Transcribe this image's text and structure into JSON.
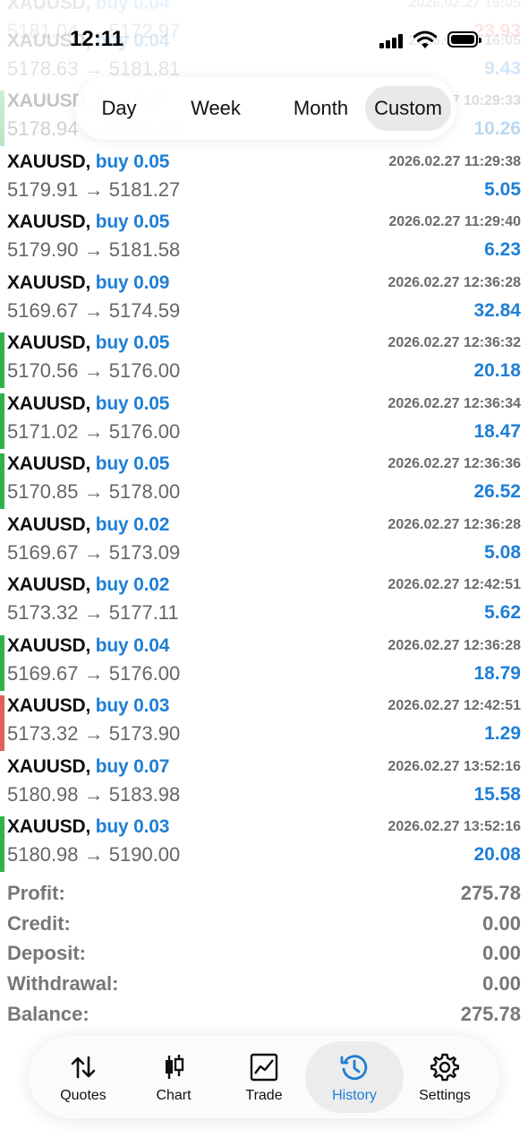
{
  "status_bar": {
    "time": "12:11"
  },
  "period_selector": {
    "options": [
      "Day",
      "Week",
      "Month",
      "Custom"
    ],
    "selected": "Custom"
  },
  "trades": [
    {
      "symbol": "XAUUSD,",
      "side": "buy 0.04",
      "time": "2026.02.27 16:05",
      "prices": "5181.04 → 5172.97",
      "profit": "-23.93",
      "marker": "none",
      "faded": true
    },
    {
      "symbol": "XAUUSD,",
      "side": "buy 0.04",
      "time": "2026.02.27 16:05",
      "prices": "5178.63 → 5181.81",
      "profit": "9.43",
      "marker": "none",
      "faded": true
    },
    {
      "symbol": "XAUUSD,",
      "side": "buy 0.04",
      "time": "2026.02.27 10:29:33",
      "prices": "5178.94 → 5183.40",
      "profit": "10.26",
      "marker": "green",
      "faded": true
    },
    {
      "symbol": "XAUUSD,",
      "side": "buy 0.05",
      "time": "2026.02.27 11:29:38",
      "prices": "5179.91 → 5181.27",
      "profit": "5.05",
      "marker": "none"
    },
    {
      "symbol": "XAUUSD,",
      "side": "buy 0.05",
      "time": "2026.02.27 11:29:40",
      "prices": "5179.90 → 5181.58",
      "profit": "6.23",
      "marker": "none"
    },
    {
      "symbol": "XAUUSD,",
      "side": "buy 0.09",
      "time": "2026.02.27 12:36:28",
      "prices": "5169.67 → 5174.59",
      "profit": "32.84",
      "marker": "none"
    },
    {
      "symbol": "XAUUSD,",
      "side": "buy 0.05",
      "time": "2026.02.27 12:36:32",
      "prices": "5170.56 → 5176.00",
      "profit": "20.18",
      "marker": "green"
    },
    {
      "symbol": "XAUUSD,",
      "side": "buy 0.05",
      "time": "2026.02.27 12:36:34",
      "prices": "5171.02 → 5176.00",
      "profit": "18.47",
      "marker": "green"
    },
    {
      "symbol": "XAUUSD,",
      "side": "buy 0.05",
      "time": "2026.02.27 12:36:36",
      "prices": "5170.85 → 5178.00",
      "profit": "26.52",
      "marker": "green"
    },
    {
      "symbol": "XAUUSD,",
      "side": "buy 0.02",
      "time": "2026.02.27 12:36:28",
      "prices": "5169.67 → 5173.09",
      "profit": "5.08",
      "marker": "none"
    },
    {
      "symbol": "XAUUSD,",
      "side": "buy 0.02",
      "time": "2026.02.27 12:42:51",
      "prices": "5173.32 → 5177.11",
      "profit": "5.62",
      "marker": "none"
    },
    {
      "symbol": "XAUUSD,",
      "side": "buy 0.04",
      "time": "2026.02.27 12:36:28",
      "prices": "5169.67 → 5176.00",
      "profit": "18.79",
      "marker": "green"
    },
    {
      "symbol": "XAUUSD,",
      "side": "buy 0.03",
      "time": "2026.02.27 12:42:51",
      "prices": "5173.32 → 5173.90",
      "profit": "1.29",
      "marker": "red"
    },
    {
      "symbol": "XAUUSD,",
      "side": "buy 0.07",
      "time": "2026.02.27 13:52:16",
      "prices": "5180.98 → 5183.98",
      "profit": "15.58",
      "marker": "none"
    },
    {
      "symbol": "XAUUSD,",
      "side": "buy 0.03",
      "time": "2026.02.27 13:52:16",
      "prices": "5180.98 → 5190.00",
      "profit": "20.08",
      "marker": "green"
    }
  ],
  "summary": [
    {
      "label": "Profit:",
      "value": "275.78"
    },
    {
      "label": "Credit:",
      "value": "0.00"
    },
    {
      "label": "Deposit:",
      "value": "0.00"
    },
    {
      "label": "Withdrawal:",
      "value": "0.00"
    },
    {
      "label": "Balance:",
      "value": "275.78"
    }
  ],
  "tab_bar": {
    "tabs": [
      {
        "label": "Quotes",
        "icon": "arrows-up-down-icon"
      },
      {
        "label": "Chart",
        "icon": "candlestick-icon"
      },
      {
        "label": "Trade",
        "icon": "trend-chart-icon"
      },
      {
        "label": "History",
        "icon": "history-clock-icon"
      },
      {
        "label": "Settings",
        "icon": "gear-icon"
      }
    ],
    "active": "History"
  },
  "colors": {
    "accent_blue": "#1f7fd6",
    "marker_green": "#2db34a",
    "marker_red": "#e0605a",
    "loss_red": "#e0403a"
  }
}
